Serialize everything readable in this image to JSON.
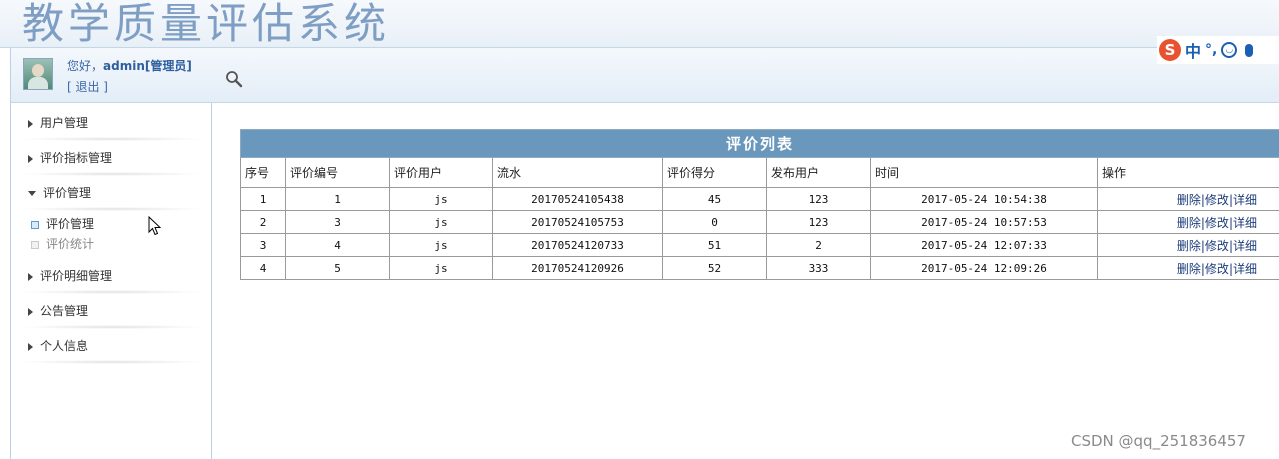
{
  "app": {
    "title": "教学质量评估系统"
  },
  "ime": {
    "logo": "S",
    "mode": "中",
    "punct": "°,",
    "icons": [
      "smiley-icon",
      "microphone-icon"
    ]
  },
  "user": {
    "greeting_prefix": "您好，",
    "name": "admin[管理员]",
    "logout_label": "[ 退出 ]"
  },
  "sidebar": {
    "items": [
      {
        "label": "用户管理",
        "expanded": false
      },
      {
        "label": "评价指标管理",
        "expanded": false
      },
      {
        "label": "评价管理",
        "expanded": true
      },
      {
        "label": "评价明细管理",
        "expanded": false
      },
      {
        "label": "公告管理",
        "expanded": false
      },
      {
        "label": "个人信息",
        "expanded": false
      }
    ],
    "subitems": [
      {
        "label": "评价管理",
        "active": true
      },
      {
        "label": "评价统计",
        "active": false
      }
    ]
  },
  "toolbar": {
    "icon": "search-icon"
  },
  "table": {
    "caption": "评价列表",
    "columns": [
      "序号",
      "评价编号",
      "评价用户",
      "流水",
      "评价得分",
      "发布用户",
      "时间",
      "操作"
    ],
    "rows": [
      [
        "1",
        "1",
        "js",
        "20170524105438",
        "45",
        "123",
        "2017-05-24 10:54:38"
      ],
      [
        "2",
        "3",
        "js",
        "20170524105753",
        "0",
        "123",
        "2017-05-24 10:57:53"
      ],
      [
        "3",
        "4",
        "js",
        "20170524120733",
        "51",
        "2",
        "2017-05-24 12:07:33"
      ],
      [
        "4",
        "5",
        "js",
        "20170524120926",
        "52",
        "333",
        "2017-05-24 12:09:26"
      ]
    ],
    "actions": {
      "delete": "删除",
      "separator": "|",
      "edit": "修改",
      "detail": "详细"
    }
  },
  "watermark": "CSDN @qq_251836457",
  "colors": {
    "caption_bg": "#6a98bd",
    "title_text": "#7f9ec4",
    "link": "#1d3c7a"
  }
}
